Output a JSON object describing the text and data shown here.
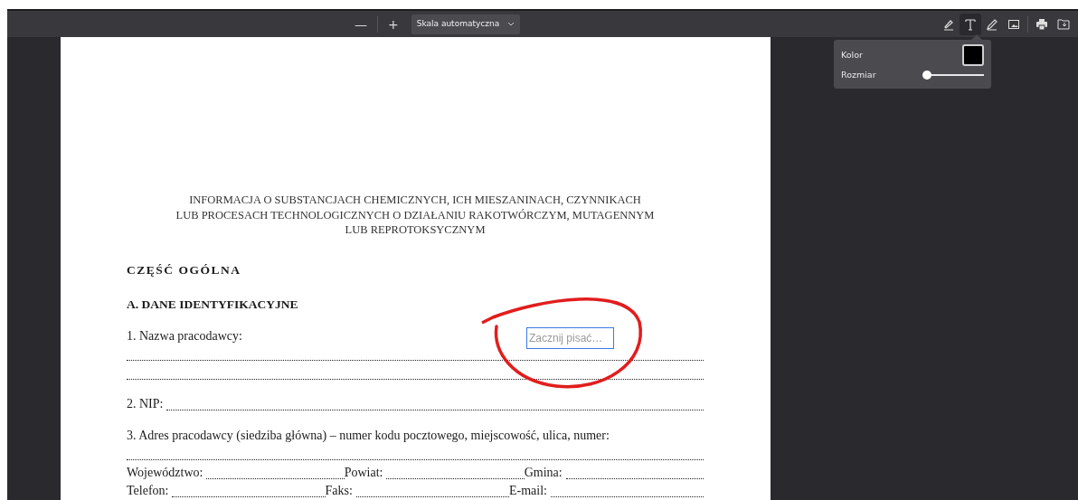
{
  "toolbar": {
    "zoom_out": "—",
    "zoom_in": "+",
    "scale": "Skala automatyczna",
    "tools": [
      {
        "kind": "highlight",
        "selected": false
      },
      {
        "kind": "text",
        "selected": true
      },
      {
        "kind": "ink",
        "selected": false
      },
      {
        "kind": "image",
        "selected": false
      }
    ]
  },
  "text_popup": {
    "color_label": "Kolor",
    "color": "#000000",
    "size_label": "Rozmiar",
    "level": 0.07
  },
  "document": {
    "title_lines": [
      "INFORMACJA O SUBSTANCJACH CHEMICZNYCH, ICH MIESZANINACH, CZYNNIKACH",
      "LUB PROCESACH TECHNOLOGICZNYCH O DZIAŁANIU RAKOTWÓRCZYM, MUTAGENNYM",
      "LUB REPROTOKSYCZNYM"
    ],
    "part_heading": "CZĘŚĆ OGÓLNA",
    "section_heading": "A. DANE IDENTYFIKACYJNE",
    "groups": [
      [
        [
          {
            "kind": "label",
            "text": "1. Nazwa pracodawcy:"
          }
        ],
        [
          {
            "kind": "line"
          }
        ],
        [
          {
            "kind": "line"
          }
        ]
      ],
      [
        [
          {
            "kind": "label",
            "text": "2. NIP:"
          },
          {
            "kind": "line"
          }
        ]
      ],
      [
        [
          {
            "kind": "label",
            "text": "3. Adres pracodawcy (siedziba główna) – numer kodu pocztowego, miejscowość, ulica, numer:"
          }
        ],
        [
          {
            "kind": "line"
          }
        ],
        [
          {
            "kind": "label",
            "text": "Województwo:"
          },
          {
            "kind": "line"
          },
          {
            "kind": "label",
            "text": "Powiat:"
          },
          {
            "kind": "line"
          },
          {
            "kind": "label",
            "text": "Gmina:"
          },
          {
            "kind": "line"
          }
        ],
        [
          {
            "kind": "label",
            "text": "Telefon:"
          },
          {
            "kind": "line"
          },
          {
            "kind": "label",
            "text": "Faks:"
          },
          {
            "kind": "line"
          },
          {
            "kind": "label",
            "text": "E-mail:"
          },
          {
            "kind": "line"
          }
        ]
      ]
    ],
    "text_box": {
      "placeholder": "Zacznij pisać…"
    },
    "annotations": [
      {
        "kind": "ink",
        "color": "#e21d1d"
      }
    ]
  }
}
